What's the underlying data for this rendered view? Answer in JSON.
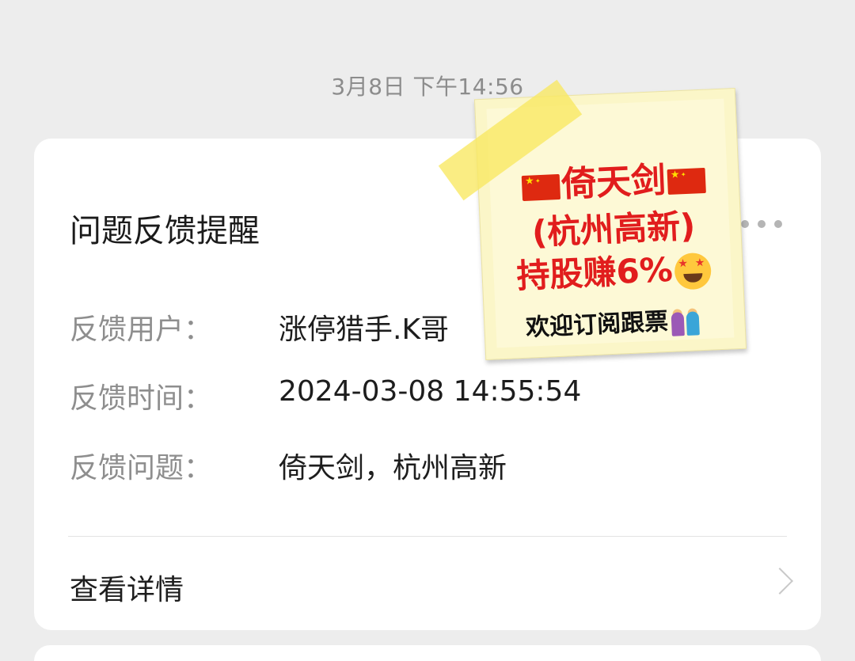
{
  "timestamp": "3月8日 下午14:56",
  "card": {
    "title": "问题反馈提醒",
    "fields": [
      {
        "label": "反馈用户：",
        "value": "涨停猎手.K哥"
      },
      {
        "label": "反馈时间：",
        "value": "2024-03-08 14:55:54"
      },
      {
        "label": "反馈问题：",
        "value": "倚天剑，杭州高新"
      }
    ],
    "detail_label": "查看详情"
  },
  "sticky_note": {
    "line1": "倚天剑",
    "line2": "(杭州高新)",
    "line3": "持股赚6%",
    "line4": "欢迎订阅跟票"
  },
  "colors": {
    "background": "#ededed",
    "card": "#ffffff",
    "note_text": "#e11d1d",
    "note_paper": "#fbf6c8",
    "tape": "#f8e860"
  },
  "icons": [
    "more-icon",
    "chevron-right-icon",
    "china-flag-icon",
    "star-struck-emoji-icon",
    "couple-emoji-icon"
  ]
}
